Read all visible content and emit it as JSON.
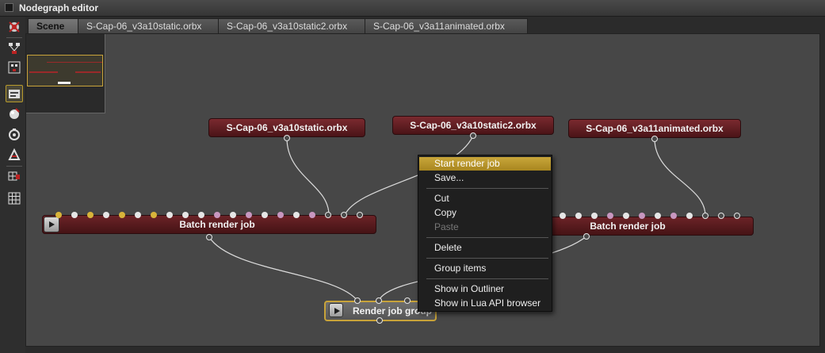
{
  "window": {
    "title": "Nodegraph editor"
  },
  "tabs": [
    {
      "label": "Scene",
      "active": true
    },
    {
      "label": "S-Cap-06_v3a10static.orbx",
      "active": false
    },
    {
      "label": "S-Cap-06_v3a10static2.orbx",
      "active": false
    },
    {
      "label": "S-Cap-06_v3a11animated.orbx",
      "active": false
    }
  ],
  "toolbar": [
    {
      "icon": "recenter-icon"
    },
    {
      "icon": "node-layout-icon"
    },
    {
      "icon": "node-inspect-icon"
    },
    {
      "icon": "render-target-icon",
      "active": true
    },
    {
      "icon": "material-icon"
    },
    {
      "icon": "camera-icon"
    },
    {
      "icon": "texture-icon"
    },
    {
      "icon": "grid-snap-icon"
    },
    {
      "icon": "grid-icon"
    }
  ],
  "nodes": {
    "source1": "S-Cap-06_v3a10static.orbx",
    "source2": "S-Cap-06_v3a10static2.orbx",
    "source3": "S-Cap-06_v3a11animated.orbx",
    "batch1": "Batch render job",
    "batch2": "Batch render job",
    "group": "Render job group"
  },
  "context_menu": {
    "items": [
      {
        "label": "Start render job",
        "highlighted": true
      },
      {
        "label": "Save..."
      },
      {
        "label": "Cut"
      },
      {
        "label": "Copy"
      },
      {
        "label": "Paste",
        "disabled": true
      },
      {
        "label": "Delete"
      },
      {
        "label": "Group items"
      },
      {
        "label": "Show in Outliner"
      },
      {
        "label": "Show in Lua API browser"
      }
    ]
  },
  "colors": {
    "node_red": "#6b2327",
    "selection_gold": "#c8a33a",
    "canvas": "#474747"
  }
}
